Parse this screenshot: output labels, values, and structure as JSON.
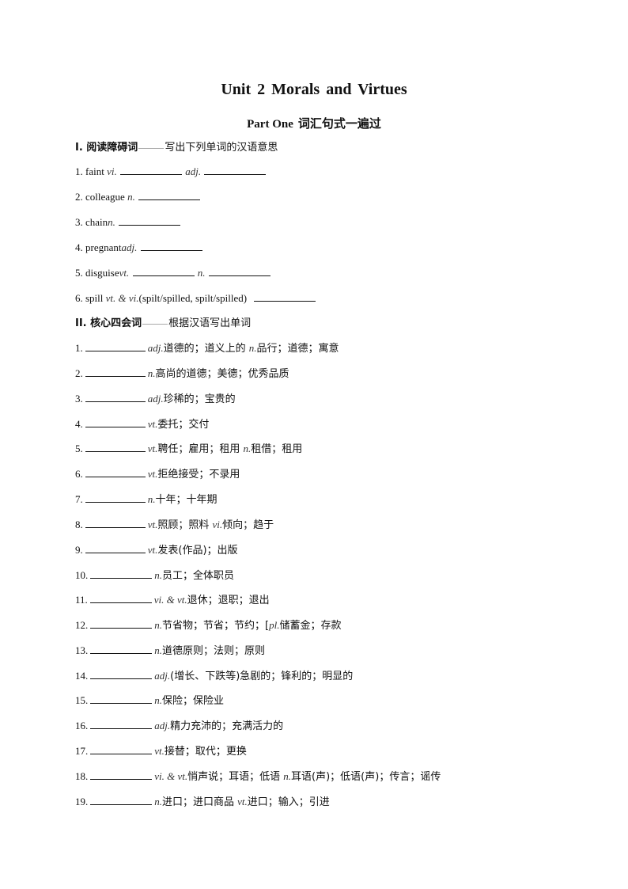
{
  "title": "Unit 2 Morals and Virtues",
  "subtitle": {
    "en": "Part One",
    "cn": "词汇句式一遍过"
  },
  "section1": {
    "label": "I. 阅读障碍词",
    "instruction": "写出下列单词的汉语意思",
    "items": [
      {
        "num": "1.",
        "word": "faint",
        "pos1": "vi.",
        "pos2": "adj."
      },
      {
        "num": "2.",
        "word": "colleague",
        "pos1": "n."
      },
      {
        "num": "3.",
        "word": "chain",
        "pos1": "n."
      },
      {
        "num": "4.",
        "word": "pregnant",
        "pos1": "adj."
      },
      {
        "num": "5.",
        "word": "disguise",
        "pos1": "vt.",
        "pos2": "n."
      },
      {
        "num": "6.",
        "word": "spill",
        "pos1": "vt. & vi.",
        "extra": "(spilt/spilled, spilt/spilled)"
      }
    ]
  },
  "section2": {
    "label": "II. 核心四会词",
    "instruction": "根据汉语写出单词",
    "items": [
      {
        "num": "1.",
        "parts": [
          {
            "pos": "adj."
          },
          {
            "text": "道德的；道义上的 "
          },
          {
            "pos": "n."
          },
          {
            "text": "品行；道德；寓意"
          }
        ]
      },
      {
        "num": "2.",
        "parts": [
          {
            "pos": "n."
          },
          {
            "text": "高尚的道德；美德；优秀品质"
          }
        ]
      },
      {
        "num": "3.",
        "parts": [
          {
            "pos": "adj."
          },
          {
            "text": "珍稀的；宝贵的"
          }
        ]
      },
      {
        "num": "4.",
        "parts": [
          {
            "pos": "vt."
          },
          {
            "text": "委托；交付"
          }
        ]
      },
      {
        "num": "5.",
        "parts": [
          {
            "pos": "vt."
          },
          {
            "text": "聘任；雇用；租用 "
          },
          {
            "pos": "n."
          },
          {
            "text": "租借；租用"
          }
        ]
      },
      {
        "num": "6.",
        "parts": [
          {
            "pos": "vt."
          },
          {
            "text": "拒绝接受；不录用"
          }
        ]
      },
      {
        "num": "7.",
        "parts": [
          {
            "pos": "n."
          },
          {
            "text": "十年；十年期"
          }
        ]
      },
      {
        "num": "8.",
        "parts": [
          {
            "pos": "vt."
          },
          {
            "text": "照顾；照料 "
          },
          {
            "pos": "vi."
          },
          {
            "text": "倾向；趋于"
          }
        ]
      },
      {
        "num": "9.",
        "parts": [
          {
            "pos": "vt."
          },
          {
            "text": "发表(作品)；出版"
          }
        ]
      },
      {
        "num": "10.",
        "parts": [
          {
            "pos": "n."
          },
          {
            "text": "员工；全体职员"
          }
        ]
      },
      {
        "num": "11.",
        "parts": [
          {
            "pos": "vi. & vt."
          },
          {
            "text": "退休；退职；退出"
          }
        ]
      },
      {
        "num": "12.",
        "parts": [
          {
            "pos": "n."
          },
          {
            "text": "节省物；节省；节约；["
          },
          {
            "pos": "pl."
          },
          {
            "text": "储蓄金；存款"
          }
        ]
      },
      {
        "num": "13.",
        "parts": [
          {
            "pos": "n."
          },
          {
            "text": "道德原则；法则；原则"
          }
        ]
      },
      {
        "num": "14.",
        "parts": [
          {
            "pos": "adj."
          },
          {
            "text": "(增长、下跌等)急剧的；锋利的；明显的"
          }
        ]
      },
      {
        "num": "15.",
        "parts": [
          {
            "pos": "n."
          },
          {
            "text": "保险；保险业"
          }
        ]
      },
      {
        "num": "16.",
        "parts": [
          {
            "pos": "adj."
          },
          {
            "text": "精力充沛的；充满活力的"
          }
        ]
      },
      {
        "num": "17.",
        "parts": [
          {
            "pos": "vt."
          },
          {
            "text": "接替；取代；更换"
          }
        ]
      },
      {
        "num": "18.",
        "parts": [
          {
            "pos": "vi. & vt."
          },
          {
            "text": "悄声说；耳语；低语 "
          },
          {
            "pos": "n."
          },
          {
            "text": "耳语(声)；低语(声)；传言；谣传"
          }
        ]
      },
      {
        "num": "19.",
        "parts": [
          {
            "pos": "n."
          },
          {
            "text": "进口；进口商品 "
          },
          {
            "pos": "vt."
          },
          {
            "text": "进口；输入；引进"
          }
        ]
      }
    ]
  }
}
